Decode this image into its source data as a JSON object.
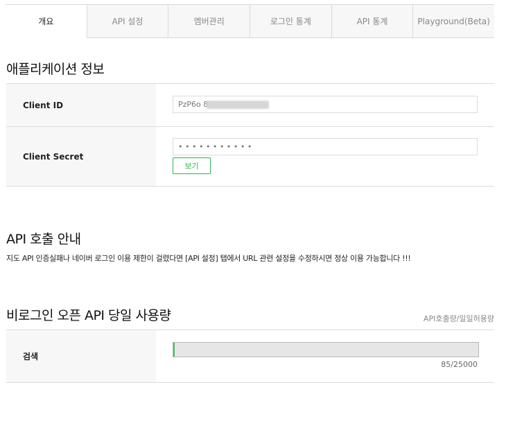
{
  "tabs": [
    {
      "label": "개요",
      "active": true
    },
    {
      "label": "API 설정",
      "active": false
    },
    {
      "label": "멤버관리",
      "active": false
    },
    {
      "label": "로그인 통계",
      "active": false
    },
    {
      "label": "API 통계",
      "active": false
    },
    {
      "label": "Playground(Beta)",
      "active": false
    }
  ],
  "app_info": {
    "title": "애플리케이션 정보",
    "client_id_label": "Client ID",
    "client_id_value": "PzP6o                    8J",
    "client_secret_label": "Client Secret",
    "client_secret_value": "• • • • • • • • • • •",
    "view_button": "보기"
  },
  "api_call": {
    "title": "API 호출 안내",
    "notice": "지도 API 인증실패나 네이버 로그인 이용 제한이 걸렸다면 [API 설정] 탭에서 URL 관련 설정을 수정하시면 정상 이용 가능합니다 !!!"
  },
  "usage": {
    "title": "비로그인 오픈 API 당일 사용량",
    "caption": "API호출량/일일허용량",
    "search_label": "검색",
    "used": 85,
    "limit": 25000,
    "display": "85/25000",
    "fill_color": "#49c15c"
  }
}
